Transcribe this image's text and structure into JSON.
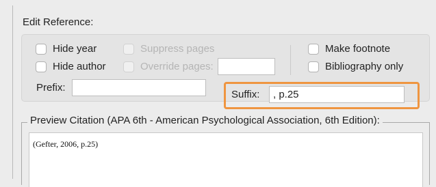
{
  "dialog": {
    "heading": "Edit Reference:"
  },
  "options": {
    "hide_year": {
      "label": "Hide year",
      "checked": false
    },
    "hide_author": {
      "label": "Hide author",
      "checked": false
    },
    "suppress_pages": {
      "label": "Suppress pages",
      "checked": false,
      "enabled": false
    },
    "override_pages": {
      "label": "Override pages:",
      "checked": false,
      "enabled": false,
      "value": ""
    },
    "make_footnote": {
      "label": "Make footnote",
      "checked": false
    },
    "bibliography_only": {
      "label": "Bibliography only",
      "checked": false
    }
  },
  "prefix": {
    "label": "Prefix:",
    "value": ""
  },
  "suffix": {
    "label": "Suffix:",
    "value": ", p.25",
    "highlight_color": "#ef9540"
  },
  "preview": {
    "title": "Preview Citation (APA 6th - American Psychological Association, 6th Edition):",
    "citation": "(Gefter, 2006, p.25)"
  }
}
